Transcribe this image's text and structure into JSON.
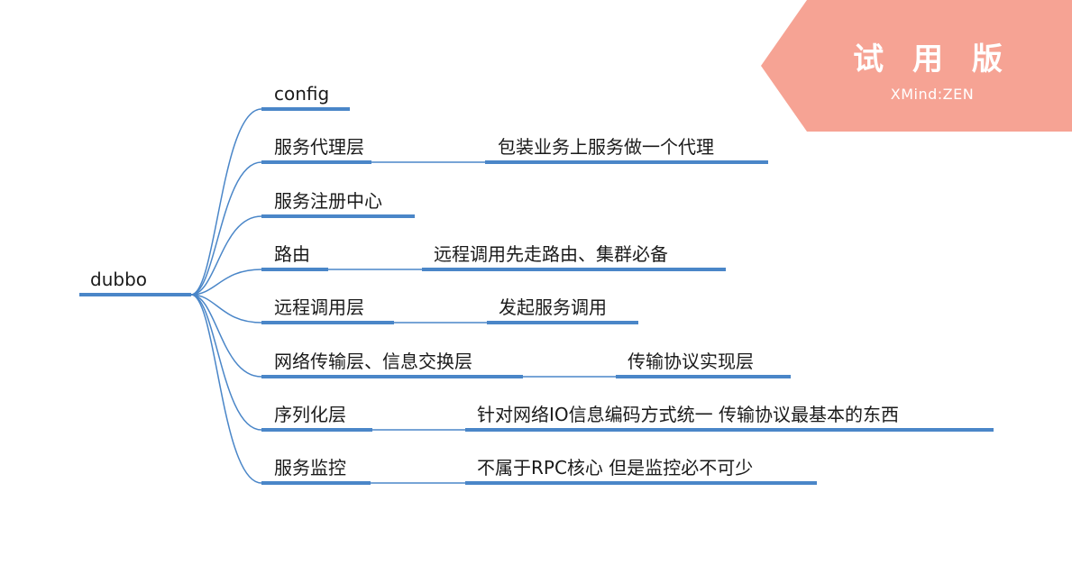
{
  "watermark": {
    "title": "试 用 版",
    "subtitle": "XMind:ZEN"
  },
  "mindmap": {
    "root": "dubbo",
    "branches": [
      {
        "label": "config",
        "detail": ""
      },
      {
        "label": "服务代理层",
        "detail": "包装业务上服务做一个代理"
      },
      {
        "label": "服务注册中心",
        "detail": ""
      },
      {
        "label": "路由",
        "detail": "远程调用先走路由、集群必备"
      },
      {
        "label": "远程调用层",
        "detail": "发起服务调用"
      },
      {
        "label": "网络传输层、信息交换层",
        "detail": "传输协议实现层"
      },
      {
        "label": "序列化层",
        "detail": "针对网络IO信息编码方式统一 传输协议最基本的东西"
      },
      {
        "label": "服务监控",
        "detail": "不属于RPC核心 但是监控必不可少"
      }
    ]
  },
  "colors": {
    "line": "#4a86c8",
    "badge": "#f6a394"
  }
}
